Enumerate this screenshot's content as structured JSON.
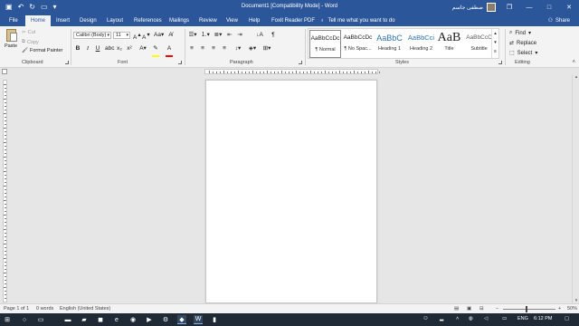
{
  "window": {
    "title": "Document1 [Compatibility Mode] - Word",
    "user_name": "ﺻﻄﻔﻰ ﺟﺎﺳﻢ",
    "controls": [
      "—",
      "❐",
      "□",
      "✕"
    ]
  },
  "qat": {
    "icons": [
      "save-icon",
      "undo-icon",
      "redo-icon",
      "open-icon",
      "customize-icon"
    ]
  },
  "tabs": [
    "File",
    "Home",
    "Insert",
    "Design",
    "Layout",
    "References",
    "Mailings",
    "Review",
    "View",
    "Help",
    "Foxit Reader PDF"
  ],
  "active_tab": "Home",
  "tell_me": "Tell me what you want to do",
  "share": "Share",
  "ribbon": {
    "clipboard": {
      "label": "Clipboard",
      "paste": "Paste",
      "cut": "Cut",
      "copy": "Copy",
      "format_painter": "Format Painter"
    },
    "font": {
      "label": "Font",
      "name": "Calibri (Body)",
      "size": "11"
    },
    "paragraph": {
      "label": "Paragraph"
    },
    "styles": {
      "label": "Styles",
      "items": [
        {
          "sample": "AaBbCcDc",
          "name": "¶ Normal"
        },
        {
          "sample": "AaBbCcDc",
          "name": "¶ No Spac..."
        },
        {
          "sample": "AaBbC",
          "name": "Heading 1"
        },
        {
          "sample": "AaBbCci",
          "name": "Heading 2"
        },
        {
          "sample": "AaB",
          "name": "Title"
        },
        {
          "sample": "AaBbCcC",
          "name": "Subtitle"
        }
      ]
    },
    "editing": {
      "label": "Editing",
      "find": "Find",
      "replace": "Replace",
      "select": "Select"
    }
  },
  "status": {
    "page": "Page 1 of 1",
    "words": "0 words",
    "language": "English (United States)",
    "zoom": "50%"
  },
  "taskbar": {
    "lang": "ENG",
    "time": "6:12 PM"
  }
}
